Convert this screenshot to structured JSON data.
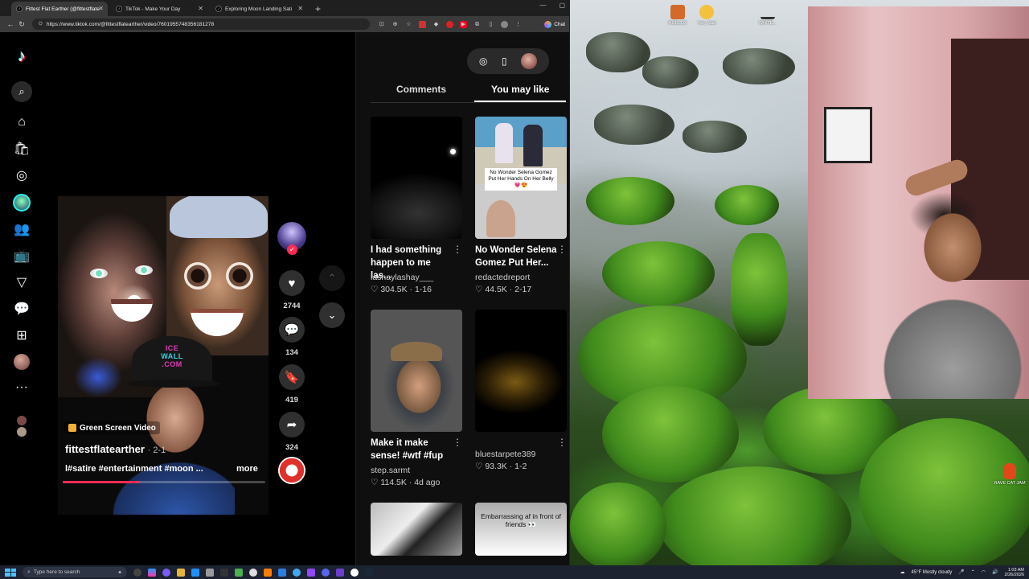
{
  "browser": {
    "tabs": [
      {
        "title": "Fittest Flat Earther (@fittestflate",
        "active": true
      },
      {
        "title": "TikTok - Make Your Day",
        "active": false
      },
      {
        "title": "Exploring Moon Landing Sati",
        "active": false
      }
    ],
    "new_tab": "+",
    "url": "https://www.tiktok.com/@fittestflatearther/video/7601955748356181278",
    "chat_label": "Chat"
  },
  "tiktok": {
    "video": {
      "effect_tag": "Green Screen Video",
      "cap_text_line1": "ICE",
      "cap_text_line2": "WALL",
      "cap_text_line3": ".COM",
      "author": "fittestflatearther",
      "date": "· 2-1",
      "caption": "l#satire #entertainment #moon ...",
      "more": "more",
      "progress_fraction": 0.38
    },
    "actions": {
      "likes": "2744",
      "comments": "134",
      "saves": "419",
      "shares": "324"
    },
    "panel": {
      "tab_comments": "Comments",
      "tab_you_may_like": "You may like",
      "active_tab": "You may like",
      "cards": [
        {
          "title": "I had something happen to me las...",
          "author": "lashaylashay___",
          "likes": "304.5K",
          "date": "1-16"
        },
        {
          "title": "No Wonder Selena Gomez Put Her...",
          "author": "redactedreport",
          "likes": "44.5K",
          "date": "2-17",
          "thumb_caption": "No Wonder Selena Gomez Put Her Hands On Her Belly 💗😍"
        },
        {
          "title": "Make it make sense! #wtf #fup",
          "author": "step.sarmt",
          "likes": "114.5K",
          "date": "4d ago"
        },
        {
          "title": "",
          "author": "bluestarpete389",
          "likes": "93.3K",
          "date": "1-2"
        },
        {
          "title": "",
          "author": "",
          "likes": "",
          "date": ""
        },
        {
          "title": "",
          "author": "",
          "likes": "",
          "date": "",
          "thumb_caption": "Embarrassing af in front of friends 👀"
        }
      ]
    }
  },
  "desktop": {
    "icons": [
      "ROBLOX",
      "Very Sad",
      "WHITE..."
    ],
    "rave_cat": "RAVE CAT JAM"
  },
  "taskbar": {
    "search_placeholder": "Type here to search",
    "weather": "45°F  Mostly cloudy",
    "time": "1:03 AM",
    "date": "2/26/2026"
  },
  "colors": {
    "tiktok_red": "#fe2c55",
    "tiktok_cyan": "#25f4ee",
    "taskbar": "#1c2230"
  }
}
